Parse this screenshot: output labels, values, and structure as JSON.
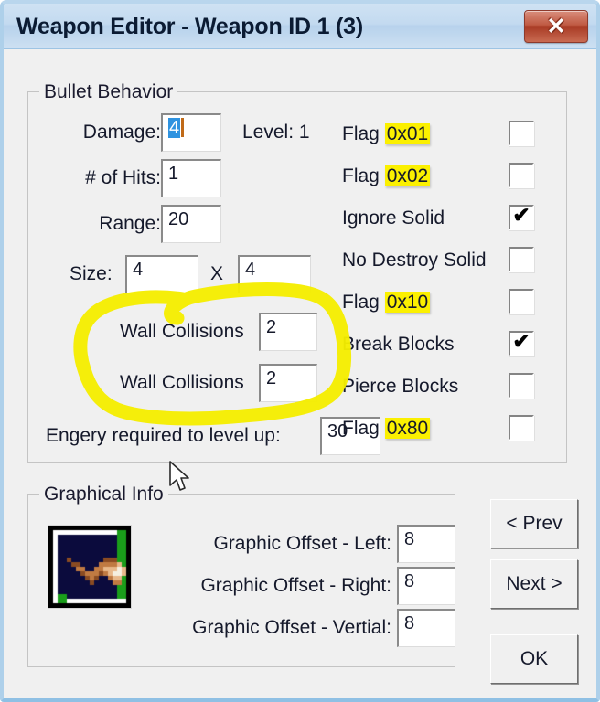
{
  "window": {
    "title": "Weapon Editor - Weapon ID 1 (3)",
    "close_label": "✖"
  },
  "bullet_behavior": {
    "legend": "Bullet Behavior",
    "damage_label": "Damage:",
    "damage_value": "4",
    "damage_selected": true,
    "level_label": "Level: 1",
    "hits_label": "# of Hits:",
    "hits_value": "1",
    "range_label": "Range:",
    "range_value": "20",
    "size_label": "Size:",
    "size_width": "4",
    "size_x_label": "X",
    "size_height": "4",
    "wall_collisions_1_label": "Wall Collisions",
    "wall_collisions_1_value": "2",
    "wall_collisions_2_label": "Wall Collisions",
    "wall_collisions_2_value": "2",
    "energy_label": "Engery required to level up:",
    "energy_value": "30"
  },
  "flags": [
    {
      "label": "Flag ",
      "hex": "0x01",
      "checked": false,
      "highlighted": true
    },
    {
      "label": "Flag ",
      "hex": "0x02",
      "checked": false,
      "highlighted": true
    },
    {
      "label": "Ignore Solid",
      "hex": "",
      "checked": true,
      "highlighted": false
    },
    {
      "label": "No Destroy Solid",
      "hex": "",
      "checked": false,
      "highlighted": false
    },
    {
      "label": "Flag ",
      "hex": "0x10",
      "checked": false,
      "highlighted": true
    },
    {
      "label": "Break Blocks",
      "hex": "",
      "checked": true,
      "highlighted": false
    },
    {
      "label": "Pierce Blocks",
      "hex": "",
      "checked": false,
      "highlighted": false
    },
    {
      "label": "Flag ",
      "hex": "0x80",
      "checked": false,
      "highlighted": true
    }
  ],
  "graphical_info": {
    "legend": "Graphical Info",
    "offset_left_label": "Graphic Offset - Left:",
    "offset_left_value": "8",
    "offset_right_label": "Graphic Offset - Right:",
    "offset_right_value": "8",
    "offset_vertical_label": "Graphic Offset - Vertial:",
    "offset_vertical_value": "8"
  },
  "buttons": {
    "prev": "< Prev",
    "next": "Next >",
    "ok": "OK"
  },
  "colors": {
    "titlebar": "#c3daf0",
    "close_button": "#c05a43",
    "dialog_background": "#f0f0f0",
    "highlight_yellow": "#fbf000",
    "annotation_yellow": "#f5ed00",
    "selection_blue": "#2f93e0",
    "caret_orange": "#c06a18",
    "window_border": "#aed0ea"
  },
  "annotation": {
    "type": "hand-drawn-circle",
    "color": "#f5ed00",
    "encircles": "wall-collisions-fields"
  },
  "sprite": {
    "background": "#0b0b3d",
    "border": "#000000",
    "guide": "#1a9e1a",
    "palette": [
      "#0b0b3d",
      "#8a4b22",
      "#c07a42",
      "#e8b88a",
      "#f5efe0",
      "#ffffff"
    ]
  }
}
